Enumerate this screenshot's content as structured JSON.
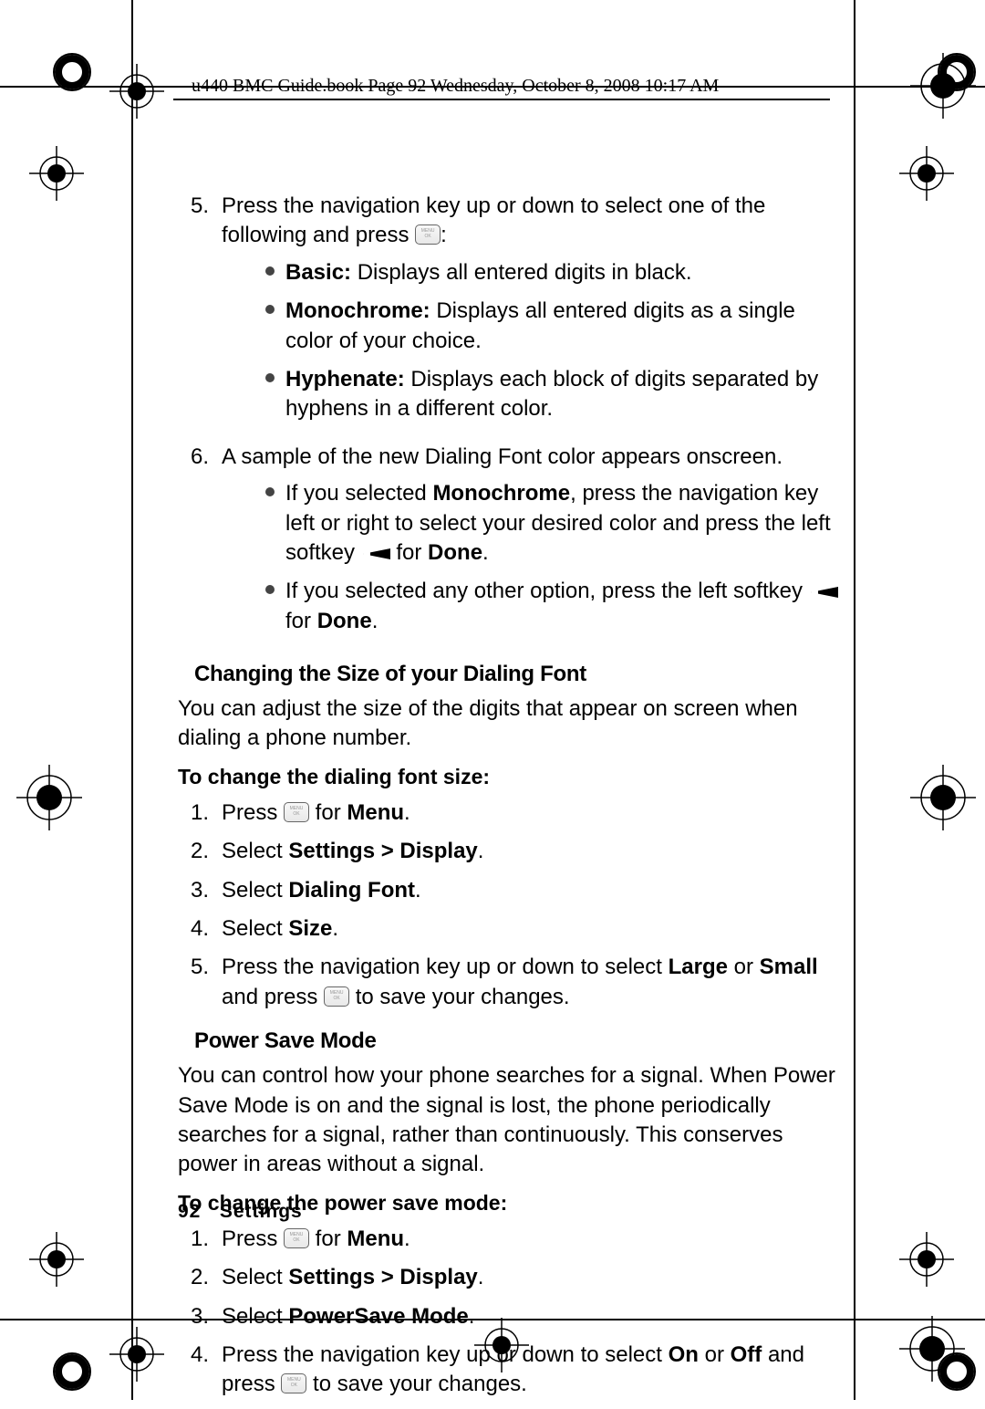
{
  "header": "u440 BMC Guide.book  Page 92  Wednesday, October 8, 2008  10:17 AM",
  "body": {
    "step5_num": "5.",
    "step5_a": "Press the navigation key up or down to select one of the following and press ",
    "step5_b": ":",
    "bullets1": {
      "b1_label": "Basic:",
      "b1_text": " Displays all entered digits in black.",
      "b2_label": "Monochrome:",
      "b2_text": " Displays all entered digits as a single color of your choice.",
      "b3_label": "Hyphenate:",
      "b3_text": " Displays each block of digits separated by hyphens in a different color."
    },
    "step6_num": "6.",
    "step6_text": "A sample of the new Dialing Font color appears onscreen.",
    "bullets2": {
      "b1_a": "If you selected ",
      "b1_b": "Monochrome",
      "b1_c": ", press the navigation key left or right to select your desired color and press the left softkey ",
      "b1_d": " for ",
      "b1_e": "Done",
      "b1_f": ".",
      "b2_a": "If you selected any other option, press the left softkey ",
      "b2_b": " for ",
      "b2_c": "Done",
      "b2_d": "."
    },
    "sec1_head": "Changing the Size of your Dialing Font",
    "sec1_para": "You can adjust the size of the digits that appear on screen when dialing a phone number.",
    "sec1_sub": "To change the dialing font size:",
    "sec1_steps": {
      "s1_num": "1.",
      "s1_a": "Press ",
      "s1_b": " for ",
      "s1_c": "Menu",
      "s1_d": ".",
      "s2_num": "2.",
      "s2_a": "Select ",
      "s2_b": "Settings > Display",
      "s2_c": ".",
      "s3_num": "3.",
      "s3_a": "Select ",
      "s3_b": "Dialing Font",
      "s3_c": ".",
      "s4_num": "4.",
      "s4_a": "Select ",
      "s4_b": "Size",
      "s4_c": ".",
      "s5_num": "5.",
      "s5_a": "Press the navigation key up or down to select ",
      "s5_b": "Large",
      "s5_c": " or ",
      "s5_d": "Small",
      "s5_e": " and press ",
      "s5_f": " to save your changes."
    },
    "sec2_head": "Power Save Mode",
    "sec2_para": "You can control how your phone searches for a signal. When Power Save Mode is on and the signal is lost, the phone periodically searches for a signal, rather than continuously. This conserves power in areas without a signal.",
    "sec2_sub": "To change the power save mode:",
    "sec2_steps": {
      "s1_num": "1.",
      "s1_a": "Press ",
      "s1_b": " for ",
      "s1_c": "Menu",
      "s1_d": ".",
      "s2_num": "2.",
      "s2_a": "Select ",
      "s2_b": "Settings > Display",
      "s2_c": ".",
      "s3_num": "3.",
      "s3_a": "Select ",
      "s3_b": "PowerSave Mode",
      "s3_c": ".",
      "s4_num": "4.",
      "s4_a": "Press the navigation key up or down to select ",
      "s4_b": "On",
      "s4_c": " or ",
      "s4_d": "Off",
      "s4_e": " and press ",
      "s4_f": " to save your changes."
    }
  },
  "footer": {
    "page": "92",
    "section": "Settings"
  }
}
